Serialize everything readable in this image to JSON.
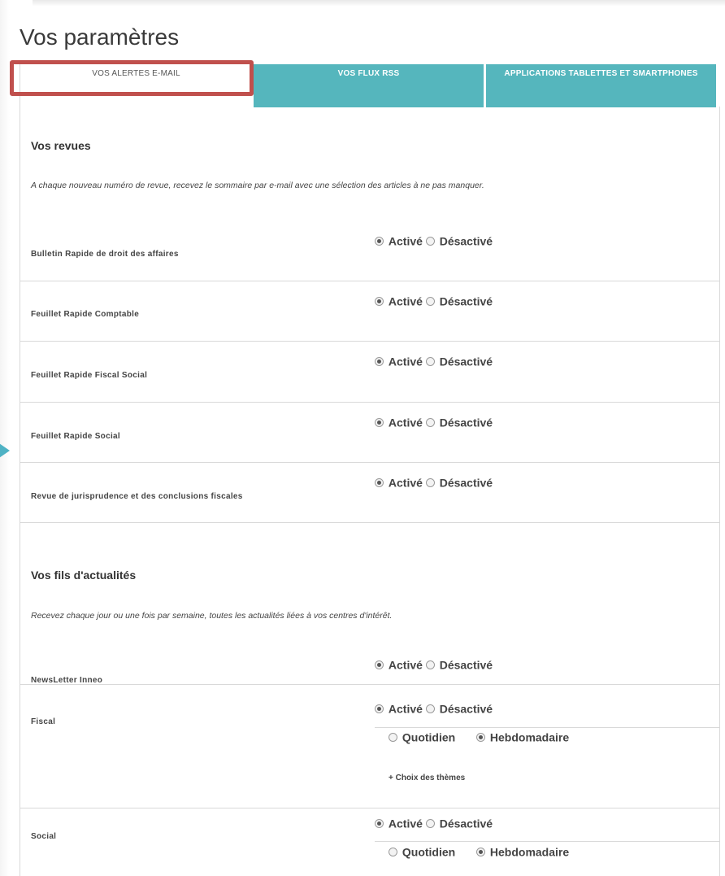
{
  "page": {
    "title": "Vos paramètres"
  },
  "tabs": [
    {
      "label": "VOS ALERTES E-MAIL",
      "active": true
    },
    {
      "label": "VOS FLUX RSS",
      "active": false
    },
    {
      "label": "APPLICATIONS TABLETTES ET SMARTPHONES",
      "active": false
    }
  ],
  "colors": {
    "tab_bg": "#55b6bd",
    "highlight": "#c0504d",
    "arrow": "#4eb2c4"
  },
  "options": {
    "on": "Activé",
    "off": "Désactivé",
    "daily": "Quotidien",
    "weekly": "Hebdomadaire"
  },
  "reviews": {
    "title": "Vos revues",
    "description": "A chaque nouveau numéro de revue, recevez le sommaire par e-mail avec une sélection des articles à ne pas manquer.",
    "items": [
      {
        "label": "Bulletin Rapide de droit des affaires",
        "state": "Activé"
      },
      {
        "label": "Feuillet Rapide Comptable",
        "state": "Activé"
      },
      {
        "label": "Feuillet Rapide Fiscal Social",
        "state": "Activé"
      },
      {
        "label": "Feuillet Rapide Social",
        "state": "Activé"
      },
      {
        "label": "Revue de jurisprudence et des conclusions fiscales",
        "state": "Activé"
      }
    ]
  },
  "news": {
    "title": "Vos fils d'actualités",
    "description": "Recevez chaque jour ou une fois par semaine, toutes les actualités liées à vos centres d'intérêt.",
    "items": [
      {
        "label": "NewsLetter Inneo",
        "state": "Activé"
      },
      {
        "label": "Fiscal",
        "state": "Activé",
        "frequency": "Hebdomadaire",
        "themes_link": "+ Choix des thèmes"
      },
      {
        "label": "Social",
        "state": "Activé",
        "frequency": "Hebdomadaire"
      }
    ]
  }
}
